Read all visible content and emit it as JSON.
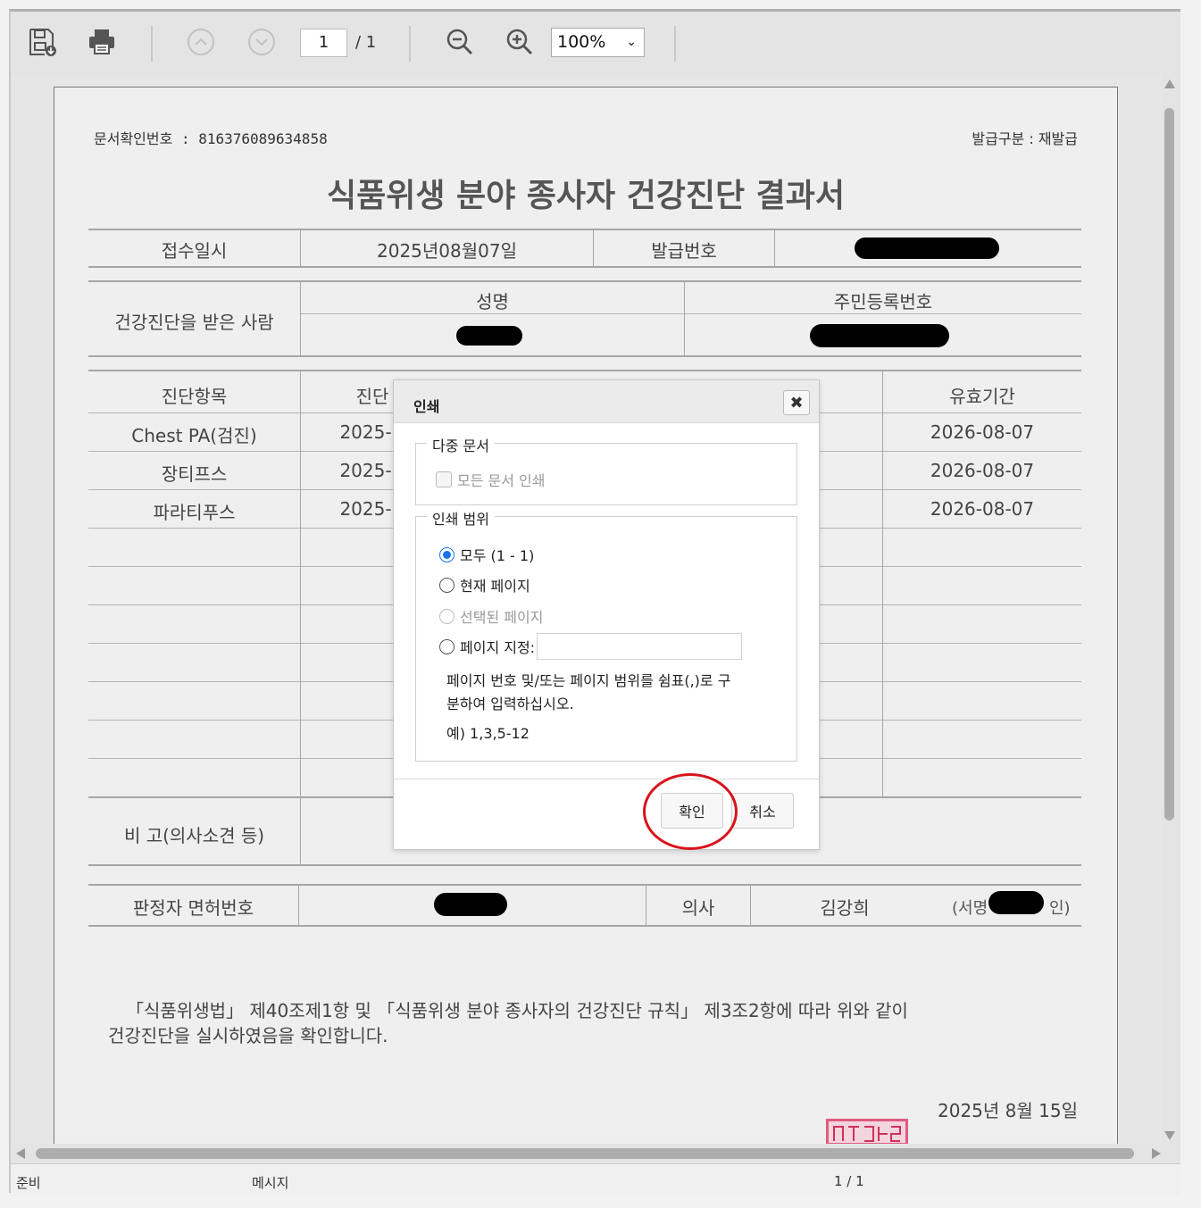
{
  "toolbar": {
    "save_icon": "save-icon",
    "print_icon": "print-icon",
    "prev_icon": "chevron-up-circle-icon",
    "next_icon": "chevron-down-circle-icon",
    "current_page": "1",
    "page_total": "/ 1",
    "zoom_out_icon": "zoom-out-icon",
    "zoom_in_icon": "zoom-in-icon",
    "zoom_value": "100%"
  },
  "document": {
    "doc_number": "문서확인번호 : 816376089634858",
    "issue_type": "발급구분 : 재발급",
    "title": "식품위생 분야 종사자 건강진단 결과서",
    "received_label": "접수일시",
    "received_value": "2025년08월07일",
    "issue_no_label": "발급번호",
    "examinee_label": "건강진단을 받은 사람",
    "name_label": "성명",
    "rrn_label": "주민등록번호",
    "item_header": "진단항목",
    "date_header": "진단",
    "validity_header": "유효기간",
    "items": [
      {
        "name": "Chest PA(검진)",
        "date": "2025-",
        "validity": "2026-08-07"
      },
      {
        "name": "장티프스",
        "date": "2025-",
        "validity": "2026-08-07"
      },
      {
        "name": "파라티푸스",
        "date": "2025-",
        "validity": "2026-08-07"
      }
    ],
    "remarks_label": "비 고(의사소견 등)",
    "license_label": "판정자 면허번호",
    "doctor_label": "의사",
    "doctor_name": "김강희",
    "signature_prefix": "(서명",
    "signature_suffix": "인)",
    "statement_line1": "「식품위생법」 제40조제1항 및 「식품위생 분야 종사자의 건강진단 규칙」 제3조2항에 따라 위와 같이",
    "statement_line2": "건강진단을 실시하였음을 확인합니다.",
    "issue_date": "2025년  8월  15일"
  },
  "dialog": {
    "title": "인쇄",
    "close_icon": "close-icon",
    "multi_doc_legend": "다중 문서",
    "print_all_docs": "모든 문서 인쇄",
    "range_legend": "인쇄 범위",
    "opt_all": "모두 (1 - 1)",
    "opt_current": "현재 페이지",
    "opt_selected": "선택된 페이지",
    "opt_custom": "페이지 지정:",
    "help_line1": "페이지 번호 및/또는 페이지 범위를 쉼표(,)로 구",
    "help_line2": "분하여 입력하십시오.",
    "example": "예) 1,3,5-12",
    "confirm": "확인",
    "cancel": "취소",
    "highlight_color": "#d8141c"
  },
  "status": {
    "ready": "준비",
    "message": "메시지",
    "pages": "1 / 1"
  }
}
